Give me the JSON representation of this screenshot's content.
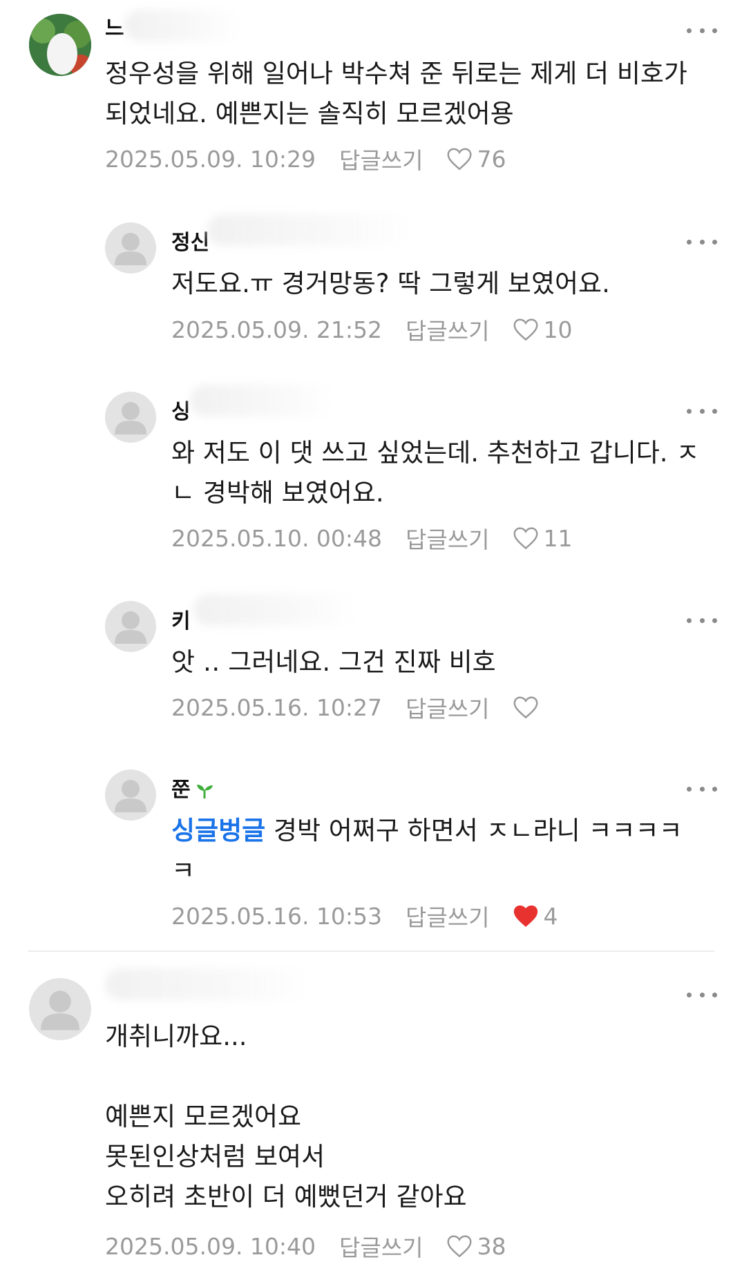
{
  "comments": [
    {
      "username": "느",
      "lines": [
        "정우성을 위해 일어나 박수쳐 준 뒤로는 제게 더 비호가",
        "되었네요. 예쁜지는 솔직히 모르겠어용"
      ],
      "date": "2025.05.09. 10:29",
      "reply_label": "답글쓰기",
      "likes": "76",
      "liked": false,
      "avatar": "photo"
    },
    {
      "username": "정신",
      "lines": [
        "저도요.ㅠ 경거망동? 딱 그렇게 보였어요."
      ],
      "date": "2025.05.09. 21:52",
      "reply_label": "답글쓰기",
      "likes": "10",
      "liked": false,
      "avatar": "default"
    },
    {
      "username": "싱",
      "lines": [
        "와 저도 이 댓 쓰고 싶었는데. 추천하고 갑니다. ㅈ",
        "ㄴ 경박해 보였어요."
      ],
      "date": "2025.05.10. 00:48",
      "reply_label": "답글쓰기",
      "likes": "11",
      "liked": false,
      "avatar": "default"
    },
    {
      "username": "키",
      "lines": [
        "앗 ‥ 그러네요. 그건 진짜 비호"
      ],
      "date": "2025.05.16. 10:27",
      "reply_label": "답글쓰기",
      "likes": "",
      "liked": false,
      "avatar": "default"
    },
    {
      "username": "쭌",
      "mention": "싱글벙글",
      "lines": [
        " 경박 어쩌구 하면서 ㅈㄴ라니 ㅋㅋㅋㅋ",
        "ㅋ"
      ],
      "date": "2025.05.16. 10:53",
      "reply_label": "답글쓰기",
      "likes": "4",
      "liked": true,
      "avatar": "default"
    },
    {
      "username": "",
      "lines": [
        "개취니까요...",
        "",
        "예쁜지 모르겠어요",
        "못된인상처럼 보여서",
        "오히려 초반이 더 예뻤던거 같아요"
      ],
      "date": "2025.05.09. 10:40",
      "reply_label": "답글쓰기",
      "likes": "38",
      "liked": false,
      "avatar": "default"
    }
  ],
  "colors": {
    "mention": "#1a73e8",
    "heart_filled": "#e8322f",
    "meta": "#9a9a9a",
    "sprout": "#3fae3b"
  }
}
